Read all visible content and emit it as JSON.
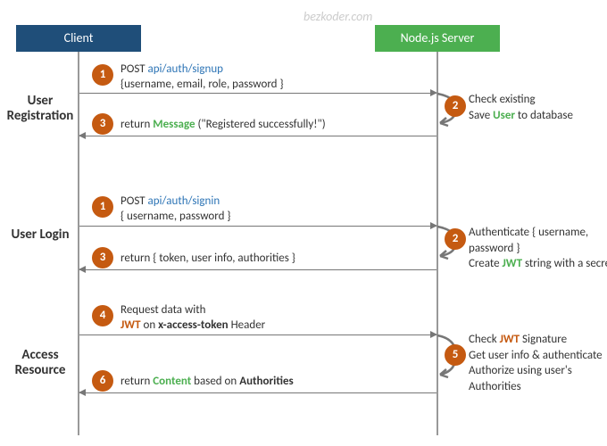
{
  "watermark": "bezkoder.com",
  "headers": {
    "client": "Client",
    "server": "Node.js Server"
  },
  "sections": {
    "registration": "User Registration",
    "login": "User Login",
    "access": "Access Resource"
  },
  "steps": {
    "reg1_prefix": "POST ",
    "reg1_api": "api/auth/signup",
    "reg1_body": "{username, email, role, password }",
    "reg2_l1": "Check existing",
    "reg2_l2a": "Save ",
    "reg2_user": "User",
    "reg2_l2b": " to database",
    "reg3_a": "return ",
    "reg3_msg": "Message",
    "reg3_b": " (\"Registered successfully!\")",
    "login1_prefix": "POST ",
    "login1_api": "api/auth/signin",
    "login1_body": "{ username, password }",
    "login2_l1": "Authenticate { username, password }",
    "login2_l2a": "Create ",
    "login2_jwt": "JWT",
    "login2_l2b": " string with a secret",
    "login3": "return { token, user info, authorities }",
    "acc4_l1": "Request  data with",
    "acc4_jwt": "JWT",
    "acc4_l2a": " on ",
    "acc4_hdr": "x-access-token",
    "acc4_l2b": " Header",
    "acc5_l1a": "Check ",
    "acc5_jwt": "JWT",
    "acc5_l1b": " Signature",
    "acc5_l2": "Get user info & authenticate",
    "acc5_l3": "Authorize using user's Authorities",
    "acc6_a": "return ",
    "acc6_content": "Content",
    "acc6_b": " based on ",
    "acc6_auth": "Authorities"
  },
  "nums": {
    "n1": "1",
    "n2": "2",
    "n3": "3",
    "n4": "4",
    "n5": "5",
    "n6": "6"
  }
}
